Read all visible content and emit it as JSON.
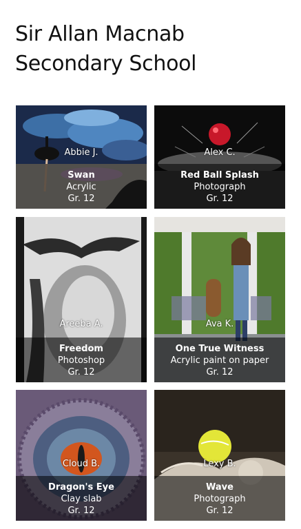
{
  "school": {
    "title_line1": "Sir Allan Macnab",
    "title_line2": "Secondary School"
  },
  "artworks": [
    {
      "artist": "Abbie J.",
      "title": "Swan",
      "medium": "Acrylic",
      "grade": "Gr. 12"
    },
    {
      "artist": "Alex C.",
      "title": "Red Ball Splash",
      "medium": "Photograph",
      "grade": "Gr. 12"
    },
    {
      "artist": "Areeba A.",
      "title": "Freedom",
      "medium": "Photoshop",
      "grade": "Gr. 12"
    },
    {
      "artist": "Ava K.",
      "title": "One True Witness",
      "medium": "Acrylic paint on paper",
      "grade": "Gr. 12"
    },
    {
      "artist": "Cloud B.",
      "title": "Dragon's Eye",
      "medium": "Clay slab",
      "grade": "Gr. 12"
    },
    {
      "artist": "Lexy B.",
      "title": "Wave",
      "medium": "Photograph",
      "grade": "Gr. 12"
    }
  ]
}
